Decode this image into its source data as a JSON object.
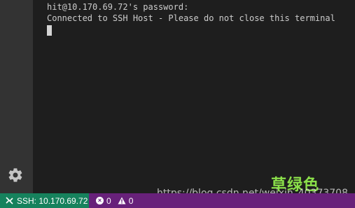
{
  "terminal": {
    "line1": "hit@10.170.69.72's password:",
    "line2": "Connected to SSH Host - Please do not close this terminal"
  },
  "statusbar": {
    "remote_label": "SSH: 10.170.69.72",
    "errors": "0",
    "warnings": "0",
    "background_color": "#68217a",
    "remote_color": "#16825d"
  },
  "icons": {
    "activity_gear": "gear-icon",
    "remote": "remote-icon",
    "errors": "error-icon",
    "warnings": "warning-icon"
  },
  "overlay": {
    "badge_text": "草绿色",
    "watermark": "https://blog.csdn.net/weixin_40373708"
  }
}
